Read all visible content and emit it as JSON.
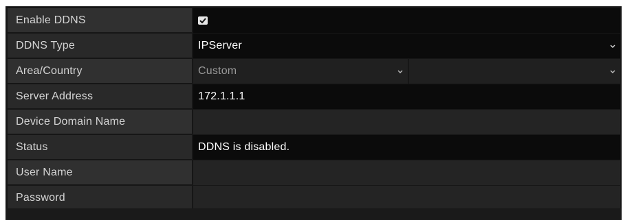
{
  "ddns_form": {
    "rows": [
      {
        "label": "Enable DDNS",
        "type": "checkbox",
        "checked": true
      },
      {
        "label": "DDNS Type",
        "type": "select",
        "value": "IPServer"
      },
      {
        "label": "Area/Country",
        "type": "dual-select",
        "value": "Custom",
        "value2": ""
      },
      {
        "label": "Server Address",
        "type": "text",
        "value": "172.1.1.1"
      },
      {
        "label": "Device Domain Name",
        "type": "text",
        "value": ""
      },
      {
        "label": "Status",
        "type": "readonly",
        "value": "DDNS is disabled."
      },
      {
        "label": "User Name",
        "type": "text",
        "value": ""
      },
      {
        "label": "Password",
        "type": "password",
        "value": ""
      }
    ]
  },
  "colors": {
    "panel_bg": "#161616",
    "label_bg": "#303030",
    "editable_bg": "#0b0b0b",
    "disabled_bg": "#202020",
    "text": "#ffffff",
    "label_text": "#d4d4d4",
    "disabled_text": "#9a9a9a"
  },
  "icons": {
    "checkbox": "check-icon",
    "dropdown": "chevron-down-icon"
  }
}
